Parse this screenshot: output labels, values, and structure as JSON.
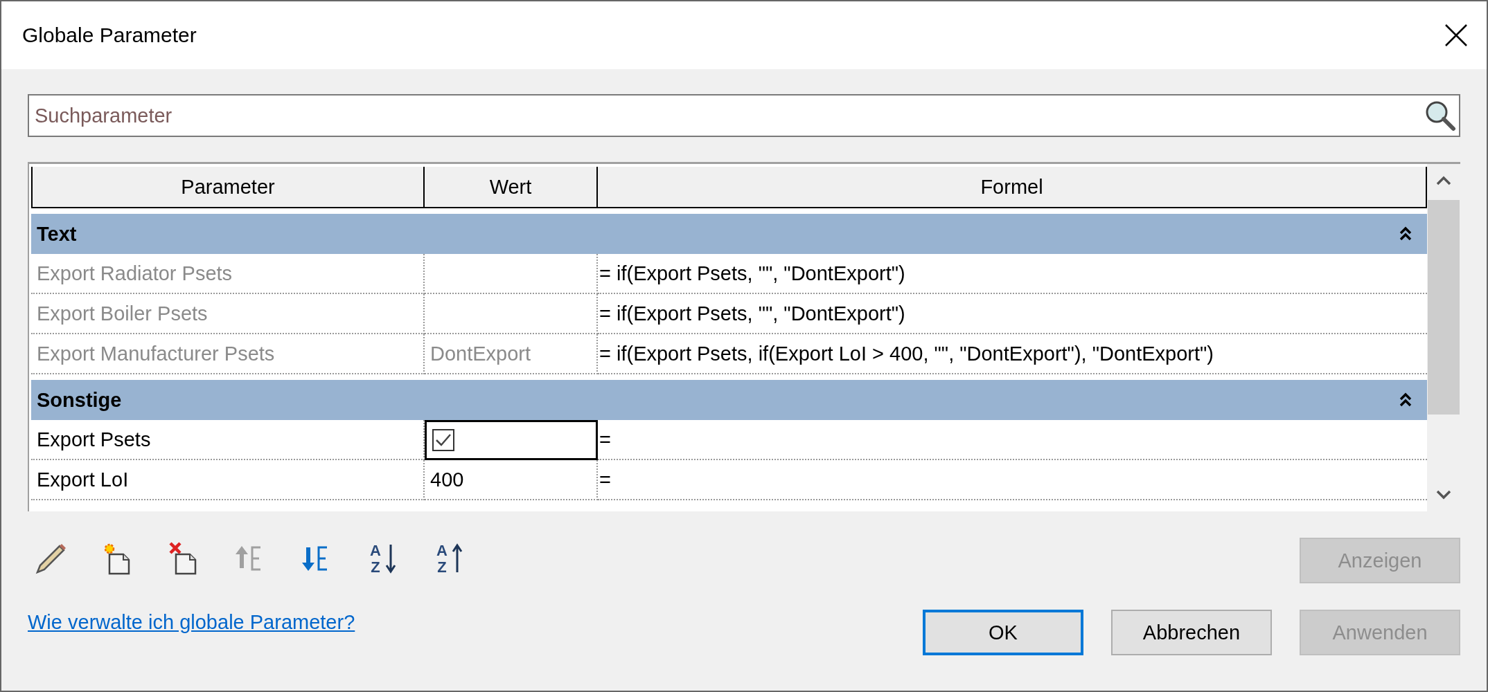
{
  "window": {
    "title": "Globale Parameter"
  },
  "search": {
    "placeholder": "Suchparameter"
  },
  "table": {
    "columns": [
      "Parameter",
      "Wert",
      "Formel"
    ],
    "groups": [
      {
        "label": "Text",
        "expanded": true,
        "rows": [
          {
            "parameter": "Export Radiator Psets",
            "kind": "text",
            "value": "",
            "formula": "= if(Export Psets, \"\", \"DontExport\")",
            "disabled": true,
            "selected": false
          },
          {
            "parameter": "Export Boiler Psets",
            "kind": "text",
            "value": "",
            "formula": "= if(Export Psets, \"\", \"DontExport\")",
            "disabled": true,
            "selected": false
          },
          {
            "parameter": "Export Manufacturer Psets",
            "kind": "text",
            "value": "DontExport",
            "formula": "= if(Export Psets, if(Export LoI > 400, \"\", \"DontExport\"), \"DontExport\")",
            "disabled": true,
            "selected": false
          }
        ]
      },
      {
        "label": "Sonstige",
        "expanded": true,
        "rows": [
          {
            "parameter": "Export Psets",
            "kind": "checkbox",
            "checked": true,
            "formula": "=",
            "disabled": false,
            "selected": true
          },
          {
            "parameter": "Export LoI",
            "kind": "text",
            "value": "400",
            "formula": "=",
            "disabled": false,
            "selected": false
          }
        ]
      }
    ]
  },
  "toolbar": [
    {
      "kind": "edit",
      "disabled": false
    },
    {
      "kind": "new",
      "disabled": false
    },
    {
      "kind": "delete",
      "disabled": false
    },
    {
      "kind": "move_up",
      "disabled": true
    },
    {
      "kind": "move_down",
      "disabled": false
    },
    {
      "kind": "sort_ascending",
      "top": "A",
      "bottom": "Z",
      "disabled": false
    },
    {
      "kind": "sort_descending",
      "top": "A",
      "bottom": "Z",
      "disabled": false
    }
  ],
  "side_button": {
    "label": "Anzeigen",
    "disabled": true,
    "default": false
  },
  "help_link": "Wie verwalte ich globale Parameter?",
  "buttons": [
    {
      "label": "OK",
      "disabled": false,
      "default": true
    },
    {
      "label": "Abbrechen",
      "disabled": false,
      "default": false
    },
    {
      "label": "Anwenden",
      "disabled": true,
      "default": false
    }
  ]
}
